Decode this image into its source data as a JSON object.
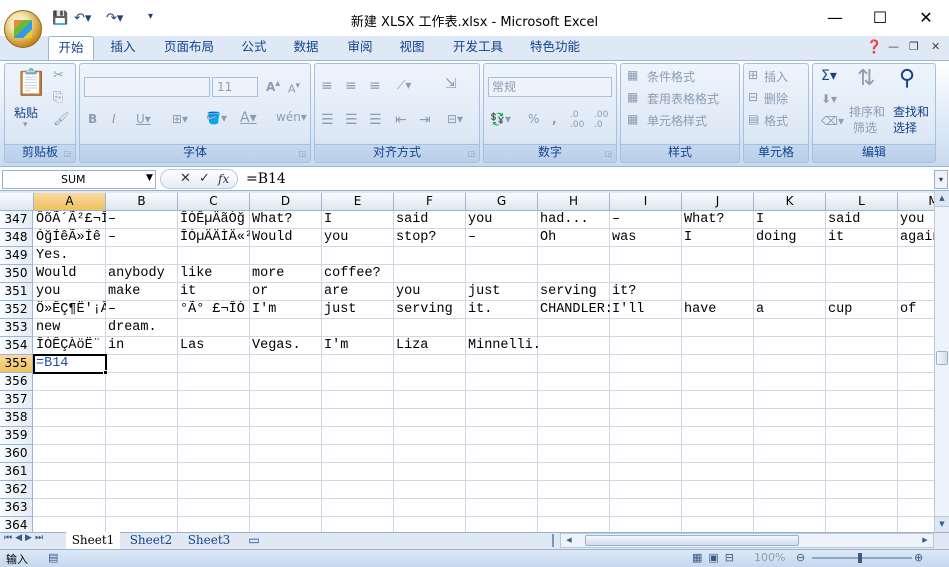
{
  "window": {
    "title": "新建 XLSX 工作表.xlsx - Microsoft Excel",
    "minimize": "—",
    "maximize": "☐",
    "close": "✕"
  },
  "ribbon_tabs": [
    "开始",
    "插入",
    "页面布局",
    "公式",
    "数据",
    "审阅",
    "视图",
    "开发工具",
    "特色功能"
  ],
  "ribbon": {
    "clipboard": {
      "label": "剪贴板",
      "paste": "粘贴"
    },
    "font": {
      "label": "字体",
      "size": "11"
    },
    "alignment": {
      "label": "对齐方式"
    },
    "number": {
      "label": "数字",
      "format": "常规"
    },
    "styles": {
      "label": "样式",
      "conditional": "条件格式",
      "table": "套用表格格式",
      "cell_styles": "单元格样式"
    },
    "cells": {
      "label": "单元格",
      "insert": "插入",
      "delete": "删除",
      "format": "格式"
    },
    "editing": {
      "label": "编辑",
      "sort": "排序和",
      "sort2": "筛选",
      "find": "查找和",
      "find2": "选择"
    }
  },
  "formula_bar": {
    "name_box": "SUM",
    "fx": "fx",
    "formula": "=B14"
  },
  "columns": [
    "A",
    "B",
    "C",
    "D",
    "E",
    "F",
    "G",
    "H",
    "I",
    "J",
    "K",
    "L",
    "M"
  ],
  "rows": [
    {
      "num": "347",
      "cells": [
        "ÔõÃ´Ã²£¬Î",
        "–",
        "ÎÒÊµÄãÒğ",
        "What?",
        "I",
        "said",
        "you",
        "had...",
        "–",
        "What?",
        "I",
        "said",
        "you"
      ]
    },
    {
      "num": "348",
      "cells": [
        "ÓğÍêÃ»Íê",
        "–",
        "ÎÒµÄÄÌÄ«²",
        "Would",
        "you",
        "stop?",
        "–",
        "Oh",
        "was",
        "I",
        "doing",
        "it",
        "again"
      ]
    },
    {
      "num": "349",
      "cells": [
        "Yes.",
        "",
        "",
        "",
        "",
        "",
        "",
        "",
        "",
        "",
        "",
        "",
        ""
      ]
    },
    {
      "num": "350",
      "cells": [
        "Would",
        "anybody",
        "like",
        "more",
        "coffee?",
        "",
        "",
        "",
        "",
        "",
        "",
        "",
        ""
      ]
    },
    {
      "num": "351",
      "cells": [
        "you",
        "make",
        "it",
        "or",
        "are",
        "you",
        "just",
        "serving",
        "it?",
        "",
        "",
        "",
        ""
      ]
    },
    {
      "num": "352",
      "cells": [
        "Ö»ÊÇ¶Ë'¡Â",
        "–",
        "°Ã° £¬ÎÒ",
        "I'm",
        "just",
        "serving",
        "it.",
        "CHANDLER:",
        "I'll",
        "have",
        "a",
        "cup",
        "of"
      ]
    },
    {
      "num": "353",
      "cells": [
        "new",
        "dream.",
        "",
        "",
        "",
        "",
        "",
        "",
        "",
        "",
        "",
        "",
        ""
      ]
    },
    {
      "num": "354",
      "cells": [
        "ÎÒÊÇÀöË¨",
        "in",
        "Las",
        "Vegas.",
        "I'm",
        "Liza",
        "Minnelli.",
        "",
        "",
        "",
        "",
        "",
        ""
      ]
    },
    {
      "num": "355",
      "cells": [
        "=B14",
        "",
        "",
        "",
        "",
        "",
        "",
        "",
        "",
        "",
        "",
        "",
        ""
      ]
    },
    {
      "num": "356",
      "cells": []
    },
    {
      "num": "357",
      "cells": []
    },
    {
      "num": "358",
      "cells": []
    },
    {
      "num": "359",
      "cells": []
    },
    {
      "num": "360",
      "cells": []
    },
    {
      "num": "361",
      "cells": []
    },
    {
      "num": "362",
      "cells": []
    },
    {
      "num": "363",
      "cells": []
    },
    {
      "num": "364",
      "cells": []
    }
  ],
  "sheets": [
    "Sheet1",
    "Sheet2",
    "Sheet3"
  ],
  "status": {
    "mode": "输入",
    "zoom": "100%"
  }
}
